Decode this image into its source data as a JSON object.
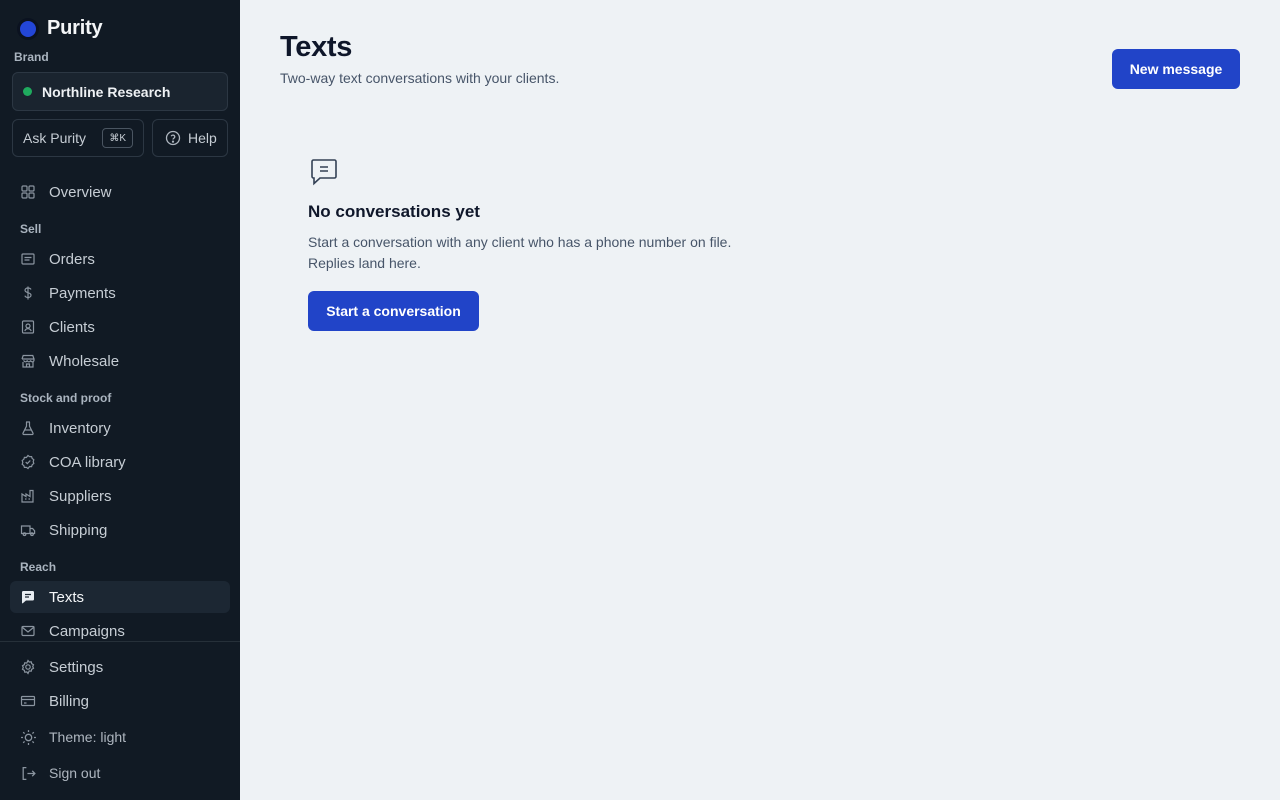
{
  "app": {
    "name": "Purity"
  },
  "sidebar": {
    "brand_label": "Brand",
    "brand_name": "Northline Research",
    "ask_label": "Ask Purity",
    "ask_shortcut": "⌘K",
    "help_label": "Help",
    "overview": "Overview",
    "sections": {
      "sell": "Sell",
      "stock": "Stock and proof",
      "reach": "Reach"
    },
    "items": {
      "orders": "Orders",
      "payments": "Payments",
      "clients": "Clients",
      "wholesale": "Wholesale",
      "inventory": "Inventory",
      "coa": "COA library",
      "suppliers": "Suppliers",
      "shipping": "Shipping",
      "texts": "Texts",
      "campaigns": "Campaigns"
    },
    "active_item": "Texts",
    "footer": {
      "settings": "Settings",
      "billing": "Billing",
      "theme": "Theme: light",
      "signout": "Sign out"
    }
  },
  "main": {
    "title": "Texts",
    "subtitle": "Two-way text conversations with your clients.",
    "new_message_label": "New message",
    "empty": {
      "title": "No conversations yet",
      "line1": "Start a conversation with any client who has a phone number on file.",
      "line2": "Replies land here.",
      "button": "Start a conversation"
    }
  },
  "colors": {
    "sidebar_bg": "#111a24",
    "main_bg": "#eef2f5",
    "accent": "#2144c8",
    "status_green": "#1faa5e"
  }
}
